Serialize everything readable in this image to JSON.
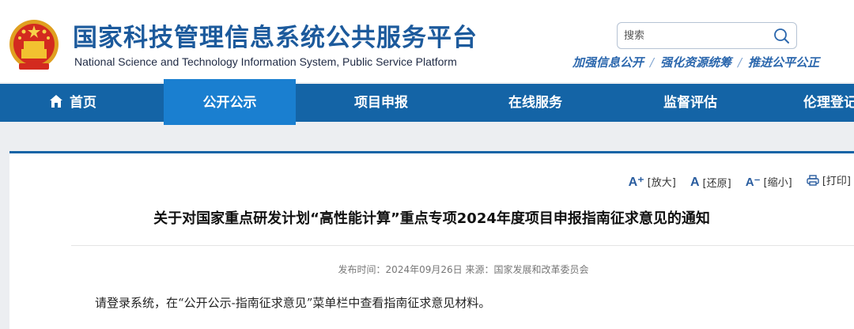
{
  "header": {
    "title": "国家科技管理信息系统公共服务平台",
    "subtitle": "National Science and Technology Information System, Public Service Platform",
    "slogan": [
      "加强信息公开",
      "强化资源统筹",
      "推进公平公正"
    ],
    "slogan_separator": "/"
  },
  "search": {
    "placeholder": "搜索"
  },
  "nav": {
    "items": [
      {
        "label": "首页",
        "icon": "home-icon"
      },
      {
        "label": "公开公示",
        "active": true
      },
      {
        "label": "项目申报"
      },
      {
        "label": "在线服务"
      },
      {
        "label": "监督评估"
      },
      {
        "label": "伦理登记"
      }
    ]
  },
  "tools": {
    "enlarge": "[放大]",
    "restore": "[还原]",
    "shrink": "[缩小]",
    "print": "[打印]"
  },
  "article": {
    "title": "关于对国家重点研发计划“高性能计算”重点专项2024年度项目申报指南征求意见的通知",
    "meta": "发布时间：2024年09月26日 来源：国家发展和改革委员会",
    "body": "请登录系统，在“公开公示-指南征求意见”菜单栏中查看指南征求意见材料。"
  },
  "colors": {
    "nav_bg": "#1464a6",
    "nav_active": "#1a7fd0",
    "title_blue": "#1c5a9c",
    "page_bg": "#eceef1"
  }
}
